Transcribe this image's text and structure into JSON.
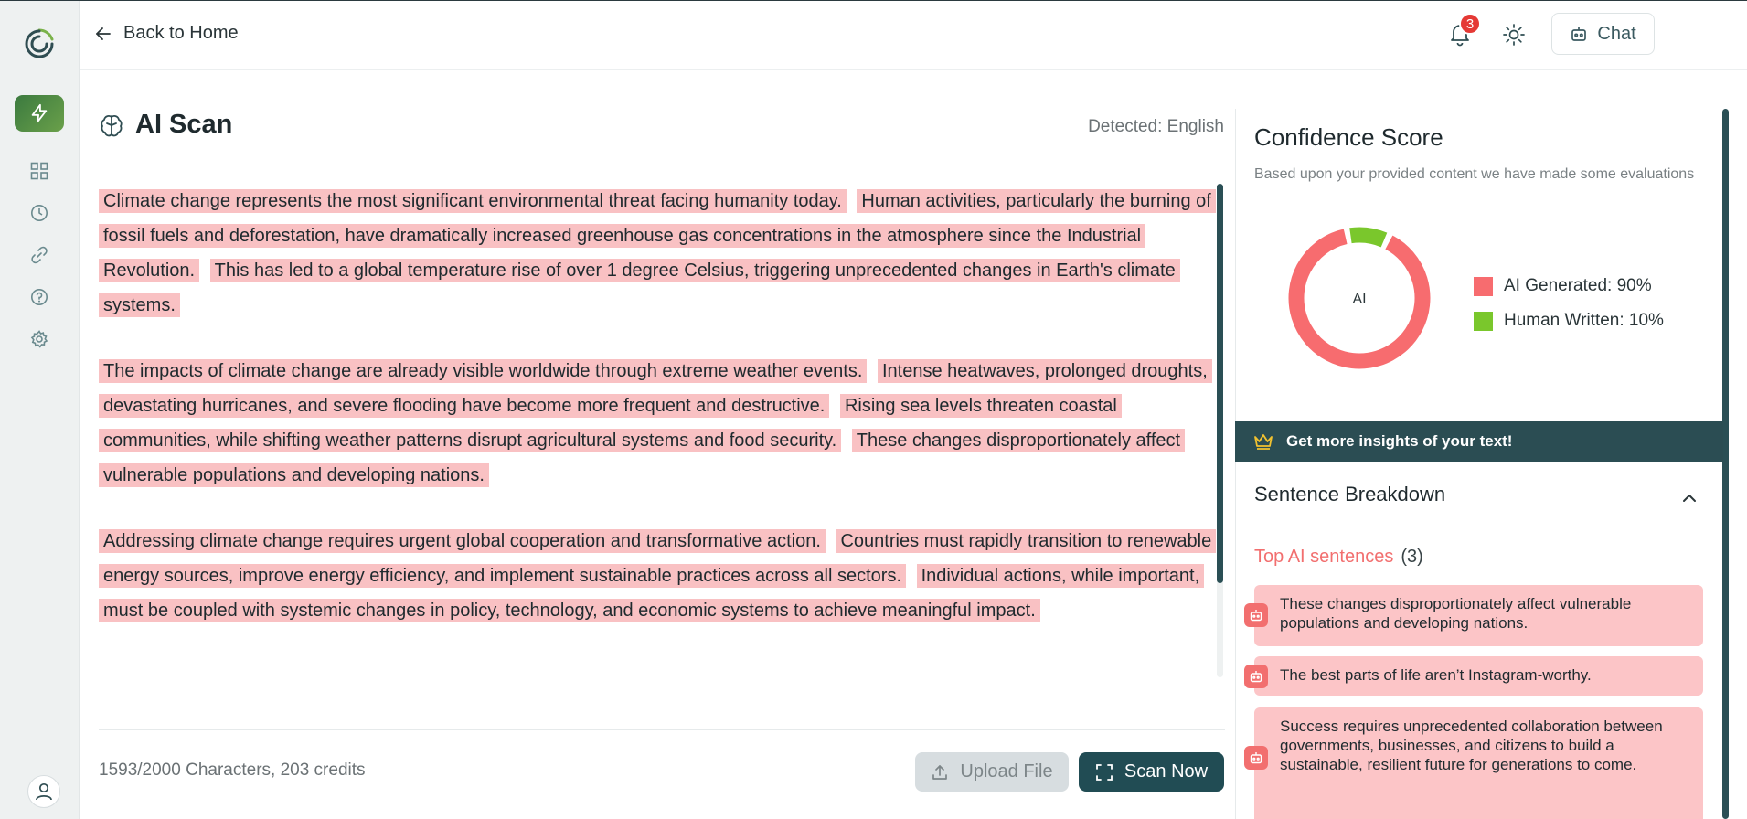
{
  "header": {
    "back_label": "Back to Home",
    "notification_count": "3",
    "chat_label": "Chat"
  },
  "sidebar": {
    "items": [
      {
        "name": "scan",
        "icon": "lightning-icon",
        "active": true
      },
      {
        "name": "dashboard",
        "icon": "grid-icon"
      },
      {
        "name": "history",
        "icon": "clock-icon"
      },
      {
        "name": "links",
        "icon": "link-icon"
      },
      {
        "name": "help",
        "icon": "help-icon"
      },
      {
        "name": "settings",
        "icon": "gear-icon"
      }
    ]
  },
  "editor": {
    "title": "AI Scan",
    "detected": "Detected: English",
    "paragraphs": [
      [
        "Climate change represents the most significant environmental threat facing humanity today.",
        "Human activities, particularly the burning of fossil fuels and deforestation, have dramatically increased greenhouse gas concentrations in the atmosphere since the Industrial Revolution.",
        "This has led to a global temperature rise of over 1 degree Celsius, triggering unprecedented changes in Earth's climate systems."
      ],
      [
        "The impacts of climate change are already visible worldwide through extreme weather events.",
        "Intense heatwaves, prolonged droughts, devastating hurricanes, and severe flooding have become more frequent and destructive.",
        "Rising sea levels threaten coastal communities, while shifting weather patterns disrupt agricultural systems and food security.",
        "These changes disproportionately affect vulnerable populations and developing nations."
      ],
      [
        "Addressing climate change requires urgent global cooperation and transformative action.",
        "Countries must rapidly transition to renewable energy sources, improve energy efficiency, and implement sustainable practices across all sectors.",
        "Individual actions, while important, must be coupled with systemic changes in policy, technology, and economic systems to achieve meaningful impact."
      ]
    ],
    "counter": "1593/2000 Characters,  203 credits",
    "upload_label": "Upload File",
    "scan_label": "Scan Now"
  },
  "confidence": {
    "title": "Confidence Score",
    "subtitle": "Based upon your provided content we have made some evaluations",
    "donut_label": "AI",
    "ai_fraction": 0.9,
    "human_fraction": 0.1,
    "legend": [
      {
        "label": "AI Generated: 90%",
        "color": "#f76c6f"
      },
      {
        "label": "Human Written: 10%",
        "color": "#7ac72c"
      }
    ]
  },
  "promo": {
    "label": "Get more insights of your text!"
  },
  "breakdown": {
    "title": "Sentence Breakdown",
    "top_label": "Top AI sentences",
    "top_count": "(3)",
    "sentences": [
      "These changes disproportionately affect vulnerable populations and developing nations.",
      "The best parts of life aren’t Instagram-worthy.",
      "Success requires unprecedented collaboration between governments, businesses, and citizens to build a sustainable, resilient future for generations to come."
    ]
  }
}
